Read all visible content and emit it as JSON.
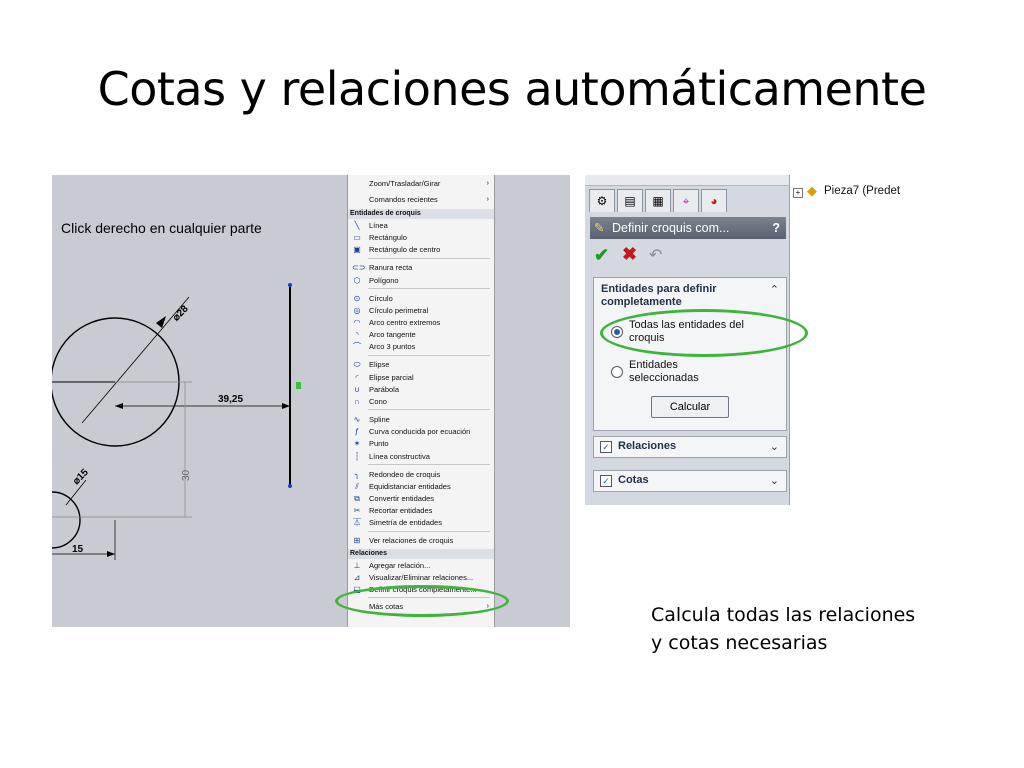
{
  "slide": {
    "title": "Cotas y relaciones automáticamente",
    "caption_line1": "Calcula todas las relaciones",
    "caption_line2": "y cotas necesarias"
  },
  "left_screenshot": {
    "instruction": "Click derecho en cualquier parte",
    "dimensions": {
      "d28": "⌀28",
      "d15": "⌀15",
      "len": "39,25",
      "v30": "30",
      "h15": "15"
    },
    "menu": {
      "top_items": [
        {
          "label": "Zoom/Trasladar/Girar",
          "submenu": true
        },
        {
          "label": "Comandos recientes",
          "submenu": true
        }
      ],
      "header_entities": "Entidades de croquis",
      "entities": [
        {
          "icon": "line-icon",
          "glyph": "╲",
          "label": "Línea"
        },
        {
          "icon": "rectangle-icon",
          "glyph": "▭",
          "label": "Rectángulo"
        },
        {
          "icon": "center-rectangle-icon",
          "glyph": "▣",
          "label": "Rectángulo de centro"
        },
        {
          "icon": "slot-icon",
          "glyph": "⊂⊃",
          "label": "Ranura recta"
        },
        {
          "icon": "polygon-icon",
          "glyph": "⬡",
          "label": "Polígono"
        },
        {
          "icon": "circle-icon",
          "glyph": "⊙",
          "label": "Círculo"
        },
        {
          "icon": "perimeter-circle-icon",
          "glyph": "◎",
          "label": "Círculo perimetral"
        },
        {
          "icon": "center-arc-icon",
          "glyph": "◠",
          "label": "Arco centro extremos"
        },
        {
          "icon": "tangent-arc-icon",
          "glyph": "◝",
          "label": "Arco tangente"
        },
        {
          "icon": "three-point-arc-icon",
          "glyph": "⌒",
          "label": "Arco 3 puntos"
        },
        {
          "icon": "ellipse-icon",
          "glyph": "⬭",
          "label": "Elipse"
        },
        {
          "icon": "partial-ellipse-icon",
          "glyph": "◜",
          "label": "Elipse parcial"
        },
        {
          "icon": "parabola-icon",
          "glyph": "∪",
          "label": "Parábola"
        },
        {
          "icon": "conic-icon",
          "glyph": "∩",
          "label": "Cono"
        },
        {
          "icon": "spline-icon",
          "glyph": "∿",
          "label": "Spline"
        },
        {
          "icon": "equation-curve-icon",
          "glyph": "ƒ",
          "label": "Curva conducida por ecuación"
        },
        {
          "icon": "point-icon",
          "glyph": "✶",
          "label": "Punto"
        },
        {
          "icon": "construction-line-icon",
          "glyph": "┆",
          "label": "Línea constructiva"
        },
        {
          "icon": "fillet-icon",
          "glyph": "╮",
          "label": "Redondeo de croquis"
        },
        {
          "icon": "offset-icon",
          "glyph": "⫽",
          "label": "Equidistanciar entidades"
        },
        {
          "icon": "convert-icon",
          "glyph": "⧉",
          "label": "Convertir entidades"
        },
        {
          "icon": "trim-icon",
          "glyph": "✂",
          "label": "Recortar entidades"
        },
        {
          "icon": "mirror-icon",
          "glyph": "⏄",
          "label": "Simetría de entidades"
        },
        {
          "icon": "view-relations-icon",
          "glyph": "⊞",
          "label": "Ver relaciones de croquis"
        }
      ],
      "header_relations": "Relaciones",
      "relations": [
        {
          "icon": "add-relation-icon",
          "glyph": "⊥",
          "label": "Agregar relación..."
        },
        {
          "icon": "delete-relations-icon",
          "glyph": "⊿",
          "label": "Visualizar/Eliminar relaciones..."
        },
        {
          "icon": "fully-define-sketch-icon",
          "glyph": "⬓",
          "label": "Definir croquis completamente..."
        }
      ],
      "more_dimensions": {
        "label": "Más cotas",
        "submenu": true
      }
    }
  },
  "right_screenshot": {
    "panel_title": "Definir croquis com...",
    "help": "?",
    "ok_glyph": "✔",
    "cancel_glyph": "✖",
    "undo_glyph": "↶",
    "section_entities": "Entidades para definir completamente",
    "radio_all": "Todas las entidades del croquis",
    "radio_selected": "Entidades seleccionadas",
    "calc_button": "Calcular",
    "section_relations": "Relaciones",
    "section_dimensions": "Cotas",
    "tree_item": "Pieza7  (Predet"
  },
  "colors": {
    "highlight_oval": "#3db53a",
    "accent": "#2b5bb0"
  }
}
